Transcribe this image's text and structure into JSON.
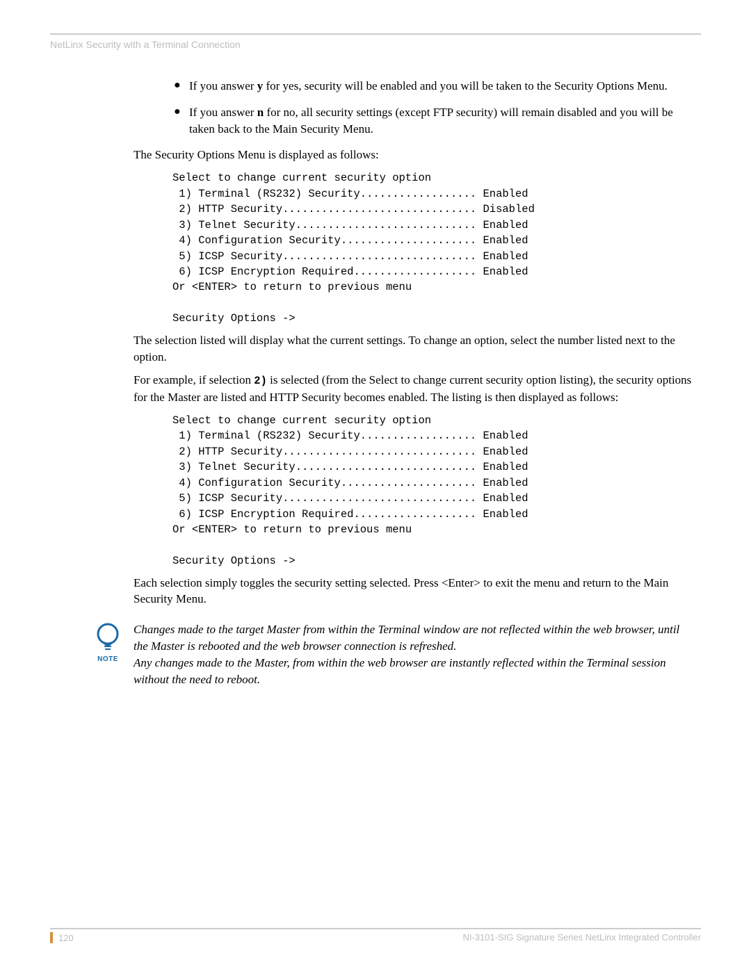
{
  "header": {
    "title": "NetLinx Security with a Terminal Connection"
  },
  "bullets": [
    {
      "prefix": "If you answer ",
      "key": "y",
      "suffix": " for yes, security will be enabled and you will be taken to the Security Options Menu."
    },
    {
      "prefix": "If you answer ",
      "key": "n",
      "suffix": " for no, all security settings (except FTP security) will remain disabled and you will be taken back to the Main Security Menu."
    }
  ],
  "para1": "The Security Options Menu is displayed as follows:",
  "menu1": "Select to change current security option\n 1) Terminal (RS232) Security.................. Enabled\n 2) HTTP Security.............................. Disabled\n 3) Telnet Security............................ Enabled\n 4) Configuration Security..................... Enabled\n 5) ICSP Security.............................. Enabled\n 6) ICSP Encryption Required................... Enabled\nOr <ENTER> to return to previous menu\n\nSecurity Options ->",
  "para2": "The selection listed will display what the current settings. To change an option, select the number listed next to the option.",
  "para3a": "For example, if selection ",
  "para3_code": "2)",
  "para3b": " is selected (from the Select to change current security option listing), the security options for the Master are listed and HTTP Security becomes enabled. The listing is then displayed as follows:",
  "menu2": "Select to change current security option\n 1) Terminal (RS232) Security.................. Enabled\n 2) HTTP Security.............................. Enabled\n 3) Telnet Security............................ Enabled\n 4) Configuration Security..................... Enabled\n 5) ICSP Security.............................. Enabled\n 6) ICSP Encryption Required................... Enabled\nOr <ENTER> to return to previous menu\n\nSecurity Options ->",
  "para4": "Each selection simply toggles the security setting selected. Press <Enter> to exit the menu and return to the Main Security Menu.",
  "note": {
    "label": "NOTE",
    "line1": "Changes made to the target Master from within the Terminal window are not reflected within the web browser, until the Master is rebooted and the web browser connection is refreshed.",
    "line2": "Any changes made to the Master, from within the web browser are instantly reflected within the Terminal session without the need to reboot."
  },
  "footer": {
    "page": "120",
    "doc": "NI-3101-SIG Signature Series NetLinx Integrated Controller"
  }
}
